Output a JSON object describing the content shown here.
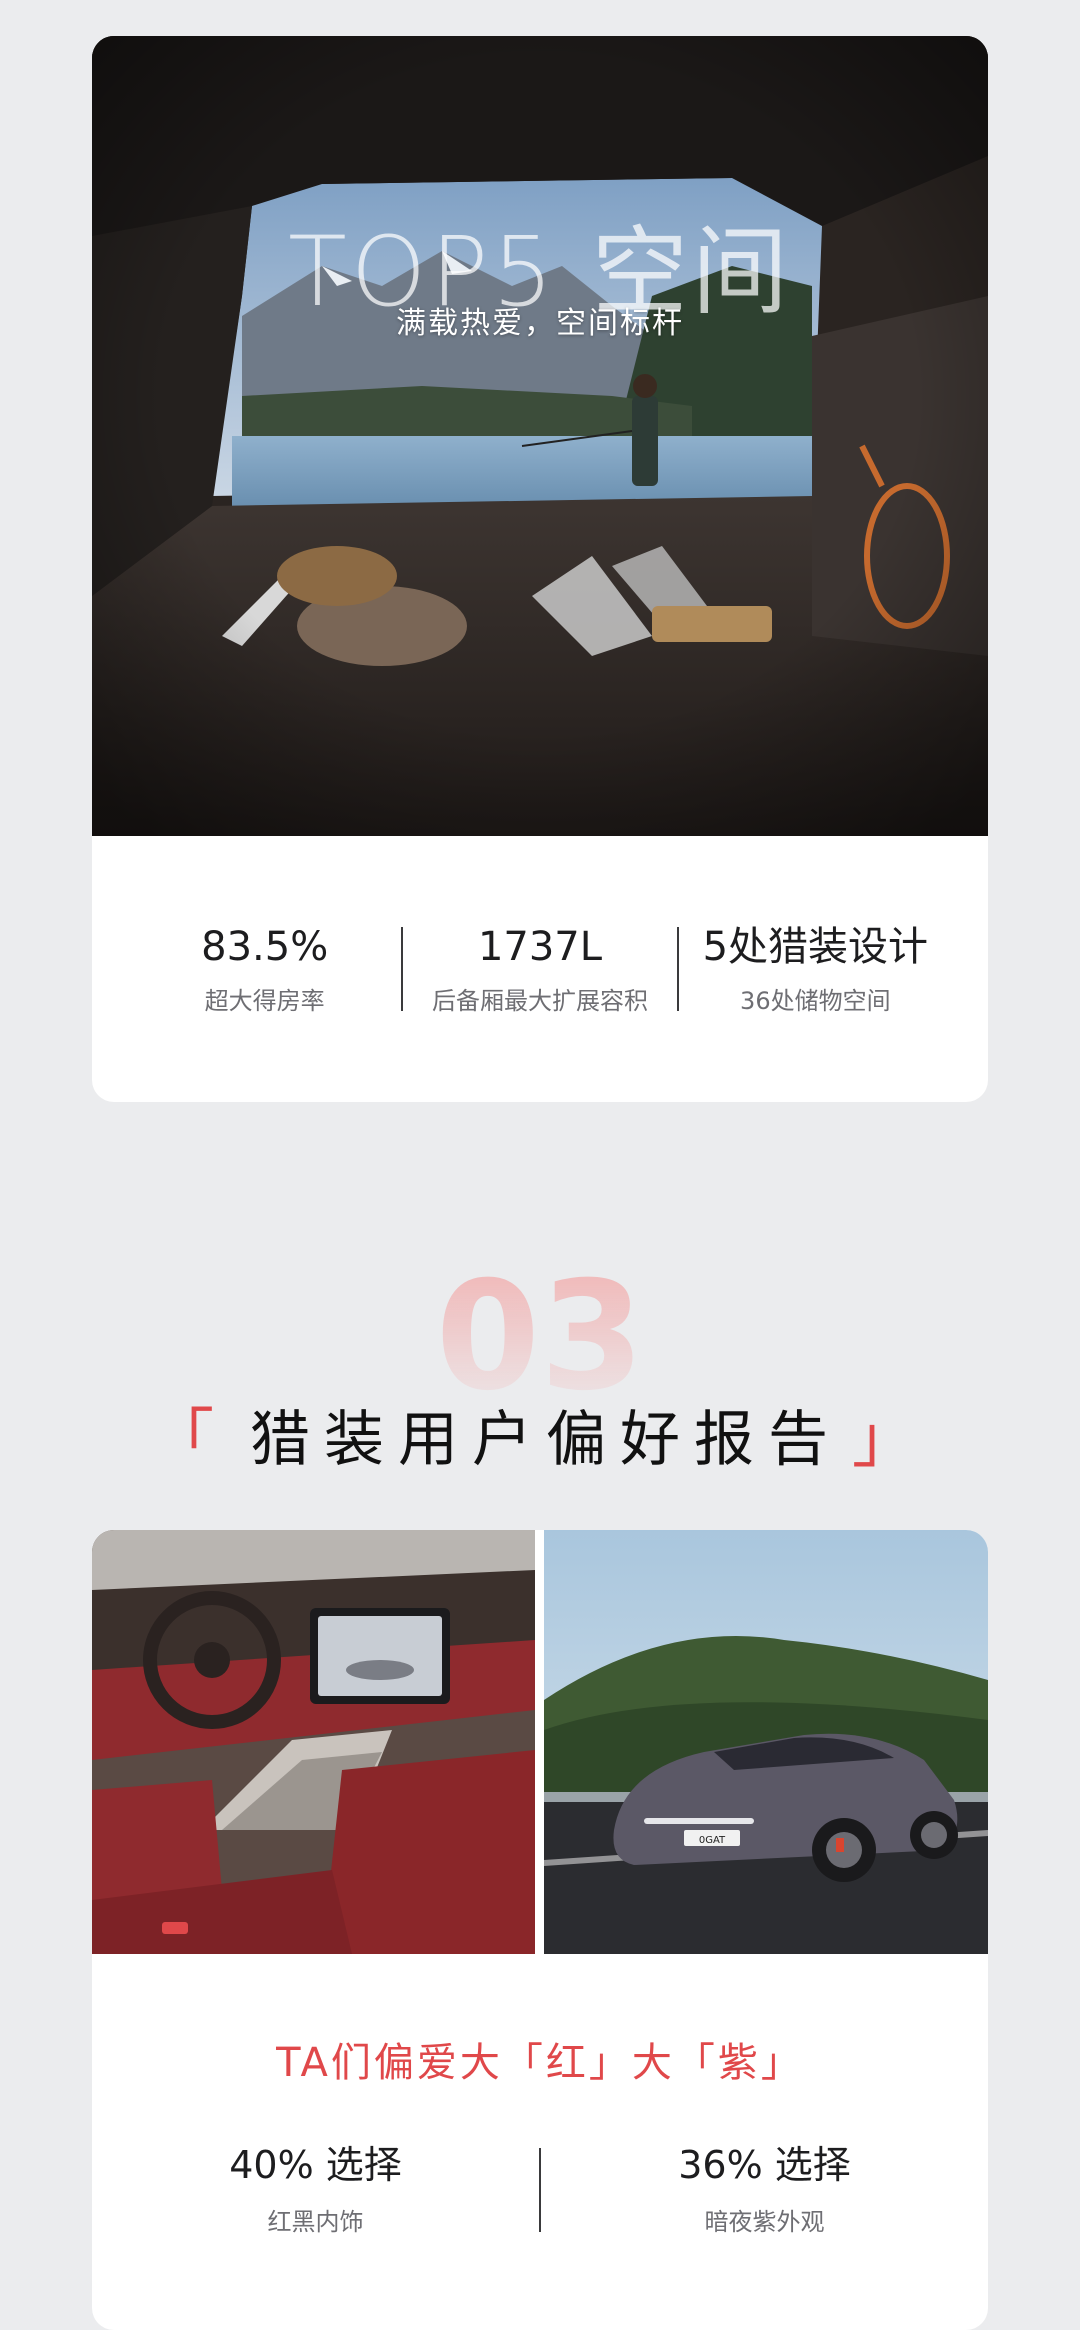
{
  "space_section": {
    "hero_title": "TOP5 空间",
    "hero_subtitle": "满载热爱，空间标杆",
    "stats": [
      {
        "value": "83.5%",
        "label": "超大得房率"
      },
      {
        "value": "1737L",
        "label": "后备厢最大扩展容积"
      },
      {
        "value": "5处猎装设计",
        "label": "36处储物空间"
      }
    ]
  },
  "report_section": {
    "number": "03",
    "bracket_left": "「",
    "title": "猎装用户偏好报告",
    "bracket_right": "」",
    "headline": "TA们偏爱大「红」大「紫」",
    "stats": [
      {
        "value": "40% 选择",
        "label": "红黑内饰"
      },
      {
        "value": "36% 选择",
        "label": "暗夜紫外观"
      }
    ],
    "car_badge": "0GAT"
  },
  "colors": {
    "accent_red": "#e0484a",
    "page_bg": "#ebecee",
    "interior_red": "#8f2a2e",
    "exterior_purple": "#5b5866"
  }
}
